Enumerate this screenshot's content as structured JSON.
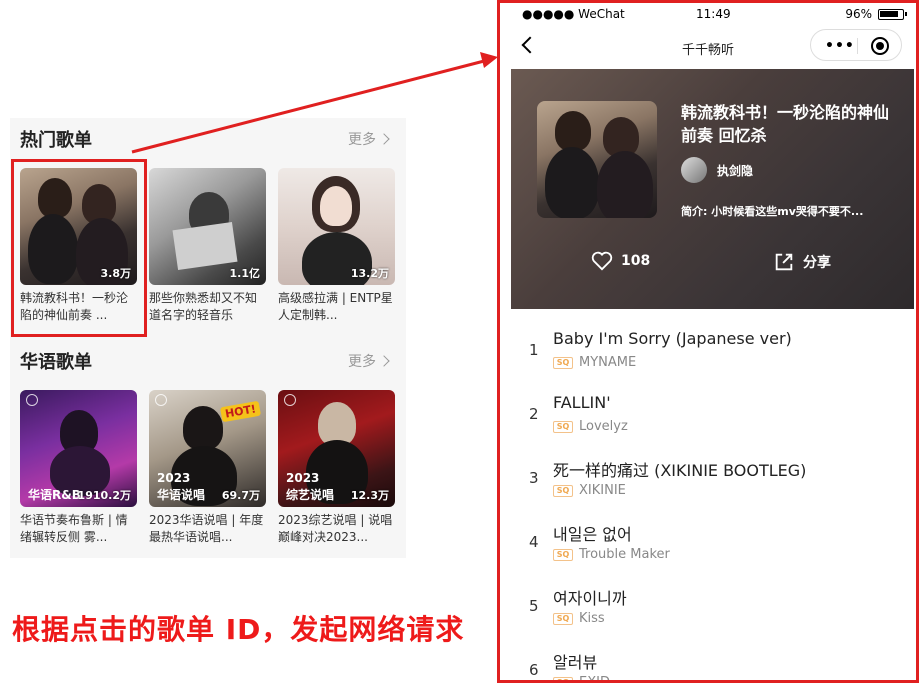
{
  "left": {
    "sections": [
      {
        "title": "热门歌单",
        "more": "更多",
        "cards": [
          {
            "count": "3.8万",
            "title": "韩流教科书！一秒沦陷的神仙前奏 ...",
            "style": "c-kdrama"
          },
          {
            "count": "1.1亿",
            "title": "那些你熟悉却又不知道名字的轻音乐",
            "style": "c-bw"
          },
          {
            "count": "13.2万",
            "title": "高级感拉满 | ENTP星人定制韩...",
            "style": "c-girl"
          }
        ]
      },
      {
        "title": "华语歌单",
        "more": "更多",
        "cards": [
          {
            "count": "1910.2万",
            "tag": "华语R&B",
            "year": "",
            "title": "华语节奏布鲁斯 | 情绪辗转反侧 雾...",
            "style": "c-purple"
          },
          {
            "count": "69.7万",
            "tag": "华语说唱",
            "year": "2023",
            "title": "2023华语说唱 | 年度最热华语说唱...",
            "style": "c-hot",
            "badge": "HOT!"
          },
          {
            "count": "12.3万",
            "tag": "综艺说唱",
            "year": "2023",
            "title": "2023综艺说唱 | 说唱巅峰对决2023...",
            "style": "c-red"
          }
        ]
      }
    ]
  },
  "caption": "根据点击的歌单 ID，发起网络请求",
  "phone": {
    "status": {
      "signal": "●●●●● WeChat",
      "time": "11:49",
      "battery": "96%"
    },
    "nav_title": "千千畅听",
    "capsule_dots": "•••",
    "hero": {
      "title": "韩流教科书！一秒沦陷的神仙前奏 回忆杀",
      "author": "执剑隐",
      "desc": "简介: 小时候看这些mv哭得不要不...",
      "likes": "108",
      "share": "分享"
    },
    "songs": [
      {
        "index": "1",
        "name": "Baby I'm Sorry (Japanese ver)",
        "quality": "SQ",
        "artist": "MYNAME"
      },
      {
        "index": "2",
        "name": "FALLIN'",
        "quality": "SQ",
        "artist": "Lovelyz"
      },
      {
        "index": "3",
        "name": "死一样的痛过 (XIKINIE BOOTLEG)",
        "quality": "SQ",
        "artist": "XIKINIE"
      },
      {
        "index": "4",
        "name": "내일은 없어",
        "quality": "SQ",
        "artist": "Trouble Maker"
      },
      {
        "index": "5",
        "name": "여자이니까",
        "quality": "SQ",
        "artist": "Kiss"
      },
      {
        "index": "6",
        "name": "알러뷰",
        "quality": "SQ",
        "artist": "EXID"
      }
    ]
  },
  "colors": {
    "accent_red": "#e02020",
    "caption_red": "#ee1a1a",
    "sq_badge": "#f0a850"
  }
}
